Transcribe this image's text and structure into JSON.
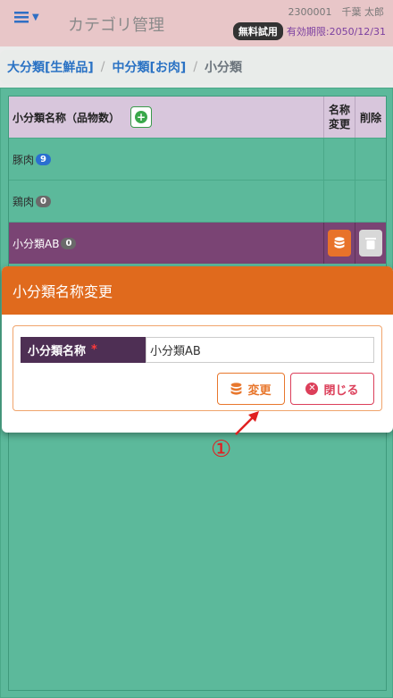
{
  "header": {
    "menu_icon": "hamburger-icon",
    "app_title": "カテゴリ管理",
    "user_id": "2300001　千葉 太郎",
    "trial_badge": "無料試用",
    "expiry": "有効期限:2050/12/31"
  },
  "breadcrumb": {
    "level1": "大分類[生鮮品]",
    "level2": "中分類[お肉]",
    "current": "小分類",
    "separator": "/"
  },
  "table": {
    "col_name": "小分類名称（品物数）",
    "col_rename_line1": "名称",
    "col_rename_line2": "変更",
    "col_delete": "削除",
    "rows": [
      {
        "name": "豚肉",
        "count": "9"
      },
      {
        "name": "鶏肉",
        "count": "0"
      },
      {
        "name": "小分類AB",
        "count": "0"
      }
    ]
  },
  "modal": {
    "title": "小分類名称変更",
    "field_label": "小分類名称",
    "required_mark": "*",
    "input_value": "小分類AB",
    "change_button": "変更",
    "close_button": "閉じる"
  },
  "annotation": {
    "number": "①"
  },
  "colors": {
    "header_bg": "#e8c6c8",
    "main_bg": "#5cb99b",
    "selected_row": "#7a4474",
    "modal_header": "#e06a1d",
    "label_bg": "#4e2f54"
  }
}
